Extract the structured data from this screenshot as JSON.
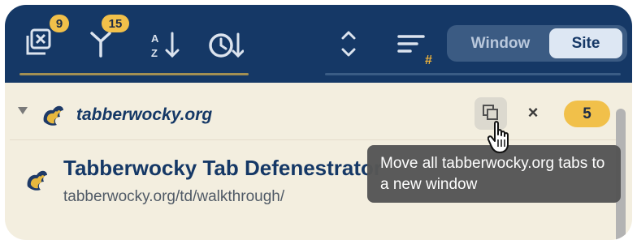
{
  "colors": {
    "topbar_bg": "#153866",
    "content_bg": "#f3eedf",
    "badge_yellow": "#f1c04a",
    "tooltip_bg": "#565656"
  },
  "toolbar": {
    "close_tabs_badge": "9",
    "merge_badge": "15",
    "sort_az_icon": "sort-alpha-icon",
    "sort_time_icon": "sort-time-icon",
    "expand_icon": "expand-collapse-icon",
    "sort_count_icon": "sort-by-count-icon",
    "sort_count_hash": "#",
    "segment": {
      "window_label": "Window",
      "site_label": "Site",
      "selected": "Site"
    }
  },
  "site_group": {
    "name": "tabberwocky.org",
    "count": "5",
    "move_icon": "move-to-window-icon",
    "close_label": "×"
  },
  "tab": {
    "title": "Tabberwocky Tab Defenestrator",
    "url": "tabberwocky.org/td/walkthrough/"
  },
  "tooltip": {
    "text": "Move all tabberwocky.org tabs to a new window"
  }
}
